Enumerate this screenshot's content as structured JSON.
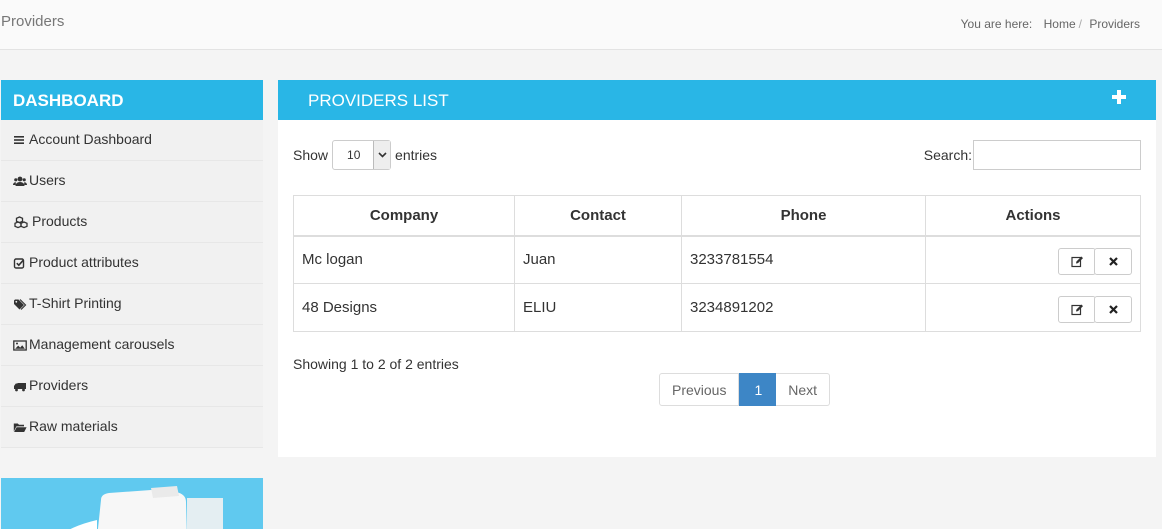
{
  "header": {
    "title": "Providers",
    "breadcrumb_label": "You are here:",
    "breadcrumb": [
      "Home",
      "Providers"
    ]
  },
  "sidebar": {
    "title": "DASHBOARD",
    "items": [
      {
        "label": "Account Dashboard",
        "icon": "bars-icon"
      },
      {
        "label": "Users",
        "icon": "users-icon"
      },
      {
        "label": "Products",
        "icon": "cubes-icon"
      },
      {
        "label": "Product attributes",
        "icon": "check-square-icon"
      },
      {
        "label": "T-Shirt Printing",
        "icon": "tags-icon"
      },
      {
        "label": "Management carousels",
        "icon": "image-icon"
      },
      {
        "label": "Providers",
        "icon": "truck-icon"
      },
      {
        "label": "Raw materials",
        "icon": "folder-open-icon"
      }
    ]
  },
  "panel": {
    "title": "PROVIDERS LIST",
    "show_label": "Show",
    "entries_value": "10",
    "entries_label": "entries",
    "search_label": "Search:",
    "search_value": "",
    "columns": [
      "Company",
      "Contact",
      "Phone",
      "Actions"
    ],
    "rows": [
      {
        "company": "Mc logan",
        "contact": "Juan",
        "phone": "3233781554"
      },
      {
        "company": "48 Designs",
        "contact": "ELIU",
        "phone": "3234891202"
      }
    ],
    "info": "Showing 1 to 2 of 2 entries",
    "pagination": {
      "previous": "Previous",
      "current": "1",
      "next": "Next"
    }
  },
  "colors": {
    "accent": "#29b6e6",
    "active_page": "#3d86c6"
  }
}
